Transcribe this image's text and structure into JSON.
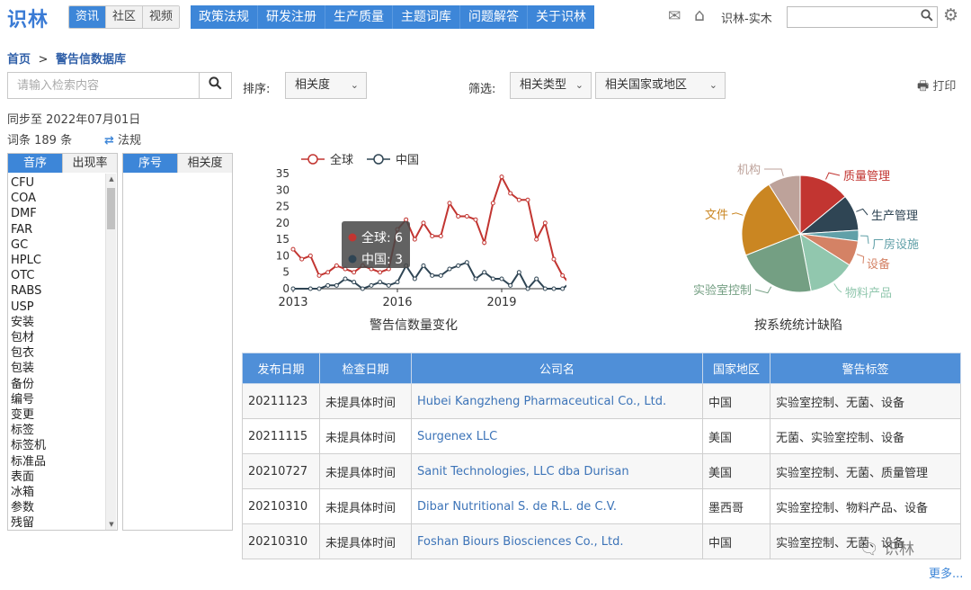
{
  "header": {
    "logo": "识林",
    "segments": [
      {
        "label": "资讯",
        "active": true
      },
      {
        "label": "社区",
        "active": false
      },
      {
        "label": "视频",
        "active": false
      }
    ],
    "nav": [
      "政策法规",
      "研发注册",
      "生产质量",
      "主题词库",
      "问题解答",
      "关于识林"
    ],
    "icons": [
      "mail-icon",
      "home-icon"
    ],
    "user": "识林-实木",
    "search_placeholder": "",
    "settings_icon": "gear-icon"
  },
  "breadcrumb": {
    "home": "首页",
    "sep": ">",
    "current": "警告信数据库"
  },
  "search": {
    "placeholder": "请输入检索内容"
  },
  "sort": {
    "label": "排序:",
    "value": "相关度"
  },
  "filter": {
    "label": "筛选:",
    "type_value": "相关类型",
    "region_value": "相关国家或地区"
  },
  "print_label": "打印",
  "sync_text": "同步至 2022年07月01日",
  "count_text": "词条 189 条",
  "law_toggle": "法规",
  "list1": {
    "tabs": [
      {
        "label": "音序",
        "active": true
      },
      {
        "label": "出现率",
        "active": false
      }
    ],
    "items": [
      "CFU",
      "COA",
      "DMF",
      "FAR",
      "GC",
      "HPLC",
      "OTC",
      "RABS",
      "USP",
      "安装",
      "包材",
      "包衣",
      "包装",
      "备份",
      "编号",
      "变更",
      "标签",
      "标签机",
      "标准品",
      "表面",
      "冰箱",
      "参数",
      "残留"
    ]
  },
  "list2": {
    "tabs": [
      {
        "label": "序号",
        "active": true
      },
      {
        "label": "相关度",
        "active": false
      }
    ]
  },
  "chart_data": [
    {
      "type": "line",
      "title": "警告信数量变化",
      "x_ticks": [
        "2013",
        "2016",
        "2019"
      ],
      "y_ticks": [
        0,
        5,
        10,
        15,
        20,
        25,
        30,
        35
      ],
      "ylim": [
        0,
        35
      ],
      "xlim": [
        2013,
        2020.5
      ],
      "legend": "top",
      "series": [
        {
          "name": "全球",
          "color": "#c23531",
          "points": [
            [
              2013.0,
              12
            ],
            [
              2013.25,
              9
            ],
            [
              2013.5,
              10
            ],
            [
              2013.75,
              4
            ],
            [
              2014.0,
              5
            ],
            [
              2014.25,
              7
            ],
            [
              2014.5,
              6
            ],
            [
              2014.75,
              5
            ],
            [
              2015.0,
              7
            ],
            [
              2015.25,
              6
            ],
            [
              2015.5,
              5
            ],
            [
              2015.75,
              6
            ],
            [
              2016.0,
              18
            ],
            [
              2016.25,
              21
            ],
            [
              2016.5,
              15
            ],
            [
              2016.75,
              20
            ],
            [
              2017.0,
              16
            ],
            [
              2017.25,
              16
            ],
            [
              2017.5,
              26
            ],
            [
              2017.75,
              22
            ],
            [
              2018.0,
              22
            ],
            [
              2018.25,
              21
            ],
            [
              2018.5,
              14
            ],
            [
              2018.75,
              26
            ],
            [
              2019.0,
              34
            ],
            [
              2019.25,
              29
            ],
            [
              2019.5,
              27
            ],
            [
              2019.75,
              27
            ],
            [
              2020.0,
              15
            ],
            [
              2020.25,
              20
            ],
            [
              2020.5,
              9
            ]
          ]
        },
        {
          "name": "中国",
          "color": "#2f4554",
          "points": [
            [
              2013.0,
              0
            ],
            [
              2013.5,
              0
            ],
            [
              2013.75,
              0
            ],
            [
              2014.0,
              1
            ],
            [
              2014.25,
              1
            ],
            [
              2014.5,
              3
            ],
            [
              2014.75,
              2
            ],
            [
              2015.0,
              0
            ],
            [
              2015.25,
              1
            ],
            [
              2015.5,
              2
            ],
            [
              2015.75,
              1
            ],
            [
              2016.0,
              2
            ],
            [
              2016.25,
              7
            ],
            [
              2016.5,
              3
            ],
            [
              2016.75,
              7
            ],
            [
              2017.0,
              4
            ],
            [
              2017.25,
              4
            ],
            [
              2017.5,
              6
            ],
            [
              2017.75,
              7
            ],
            [
              2018.0,
              8
            ],
            [
              2018.25,
              3
            ],
            [
              2018.5,
              5
            ],
            [
              2018.75,
              3
            ],
            [
              2019.0,
              3
            ],
            [
              2019.25,
              1
            ],
            [
              2019.5,
              5
            ],
            [
              2019.75,
              0
            ],
            [
              2020.0,
              3
            ],
            [
              2020.25,
              0
            ],
            [
              2020.5,
              0
            ]
          ]
        }
      ],
      "tail_points": {
        "全球": [
          [
            2020.75,
            4
          ],
          [
            2021.0,
            1
          ],
          [
            2021.2,
            1
          ]
        ],
        "中国": [
          [
            2020.75,
            0
          ],
          [
            2021.0,
            2
          ],
          [
            2021.2,
            0
          ]
        ]
      },
      "tooltip": {
        "rows": [
          {
            "name": "全球",
            "value": 6
          },
          {
            "name": "中国",
            "value": 3
          }
        ]
      }
    },
    {
      "type": "pie",
      "title": "按系统统计缺陷",
      "slices": [
        {
          "label": "质量管理",
          "value": 14,
          "color": "#c23531"
        },
        {
          "label": "生产管理",
          "value": 10,
          "color": "#2f4554"
        },
        {
          "label": "厂房设施",
          "value": 3,
          "color": "#61a0a8"
        },
        {
          "label": "设备",
          "value": 7,
          "color": "#d48265"
        },
        {
          "label": "物料产品",
          "value": 13,
          "color": "#91c7ae"
        },
        {
          "label": "实验室控制",
          "value": 22,
          "color": "#749f83"
        },
        {
          "label": "文件",
          "value": 22,
          "color": "#ca8622"
        },
        {
          "label": "机构",
          "value": 9,
          "color": "#bda29a"
        }
      ]
    }
  ],
  "table": {
    "headers": [
      "发布日期",
      "检查日期",
      "公司名",
      "国家地区",
      "警告标签"
    ],
    "rows": [
      [
        "20211123",
        "未提具体时间",
        "Hubei Kangzheng Pharmaceutical Co., Ltd.",
        "中国",
        "实验室控制、无菌、设备"
      ],
      [
        "20211115",
        "未提具体时间",
        "Surgenex LLC",
        "美国",
        "无菌、实验室控制、设备"
      ],
      [
        "20210727",
        "未提具体时间",
        "Sanit Technologies, LLC dba Durisan",
        "美国",
        "实验室控制、无菌、质量管理"
      ],
      [
        "20210310",
        "未提具体时间",
        "Dibar Nutritional S. de R.L. de C.V.",
        "墨西哥",
        "实验室控制、物料产品、设备"
      ],
      [
        "20210310",
        "未提具体时间",
        "Foshan Biours Biosciences Co., Ltd.",
        "中国",
        "实验室控制、无菌、设备"
      ]
    ],
    "more": "更多..."
  },
  "watermark": "识林"
}
